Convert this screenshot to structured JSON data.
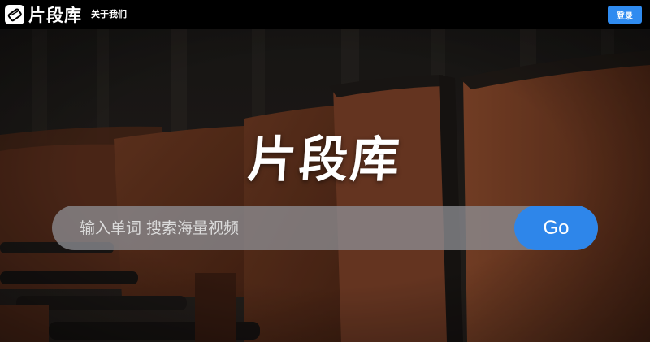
{
  "header": {
    "logo_text": "片段库",
    "logo_icon": "film-clip-icon",
    "about_label": "关于我们",
    "login_label": "登录"
  },
  "hero": {
    "title": "片段库",
    "background": "theater-seats-photo"
  },
  "search": {
    "placeholder": "输入单词 搜索海量视频",
    "value": "",
    "go_label": "Go"
  },
  "colors": {
    "accent": "#2e86ea",
    "topbar": "#000000",
    "search_bg": "#8c8c91"
  }
}
